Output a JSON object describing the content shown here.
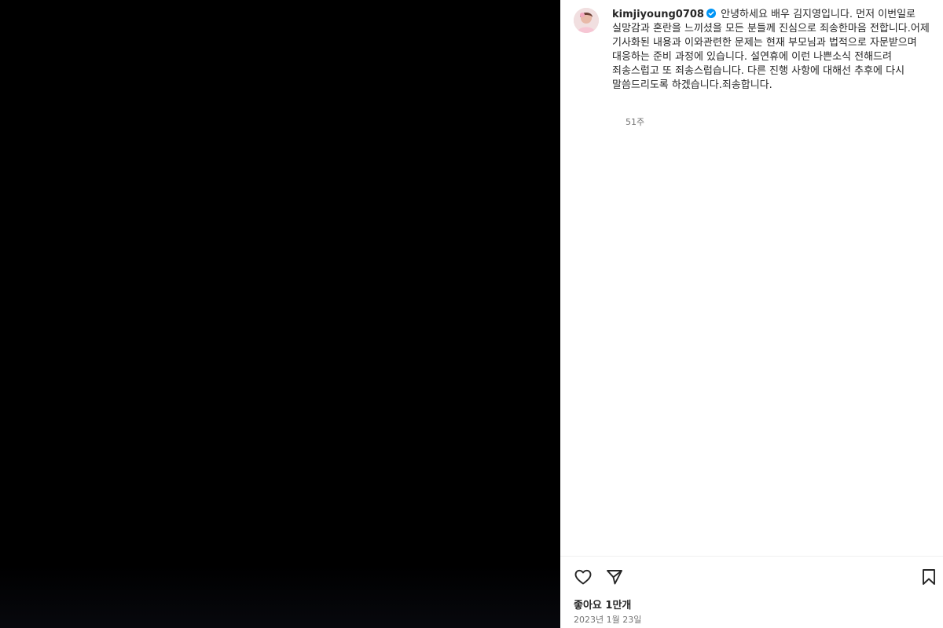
{
  "post": {
    "username": "kimjiyoung0708",
    "verified": true,
    "caption": "안녕하세요 배우 김지영입니다. 먼저 이번일로 실망감과 혼란을 느끼셨을 모든 분들께 진심으로 죄송한마음 전합니다.어제 기사화된 내용과 이와관련한 문제는 현재 부모님과 법적으로 자문받으며 대응하는 준비 과정에 있습니다. 설연휴에 이런 나쁜소식 전해드려 죄송스럽고 또 죄송스럽습니다. 다른 진행 사항에 대해선 추후에 다시 말씀드리도록 하겠습니다.죄송합니다.",
    "time_ago": "51주",
    "likes_label": "좋아요 1만개",
    "date_label": "2023년 1월 23일"
  },
  "icons": {
    "like": "heart-outline-icon",
    "share": "paper-plane-icon",
    "save": "bookmark-outline-icon",
    "verified": "verified-badge-icon",
    "avatar": "profile-avatar"
  },
  "colors": {
    "media_background": "#000000",
    "verified_blue": "#0095f6",
    "secondary_text": "#737373"
  }
}
